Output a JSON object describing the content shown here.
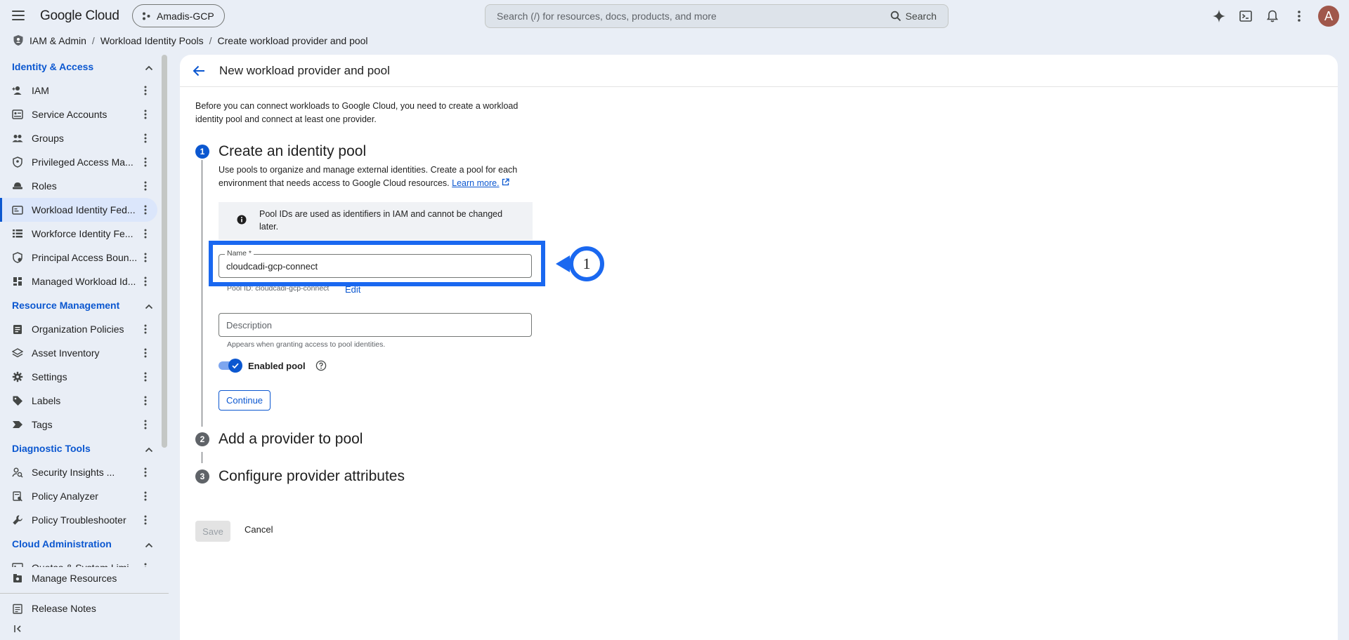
{
  "topbar": {
    "logo": "Google Cloud",
    "project": "Amadis-GCP",
    "search_placeholder": "Search (/) for resources, docs, products, and more",
    "search_button": "Search",
    "avatar_initial": "A"
  },
  "breadcrumb": {
    "section": "IAM & Admin",
    "parent": "Workload Identity Pools",
    "current": "Create workload provider and pool",
    "separator": "/"
  },
  "sidebar": {
    "sections": [
      {
        "title": "Identity & Access",
        "items": [
          {
            "label": "IAM",
            "icon": "person-add-icon"
          },
          {
            "label": "Service Accounts",
            "icon": "service-account-icon"
          },
          {
            "label": "Groups",
            "icon": "groups-icon"
          },
          {
            "label": "Privileged Access Ma...",
            "icon": "shield-icon"
          },
          {
            "label": "Roles",
            "icon": "roles-icon"
          },
          {
            "label": "Workload Identity Fed...",
            "icon": "id-card-icon",
            "active": true
          },
          {
            "label": "Workforce Identity Fe...",
            "icon": "list-icon"
          },
          {
            "label": "Principal Access Boun...",
            "icon": "policy-shield-icon"
          },
          {
            "label": "Managed Workload Id...",
            "icon": "dashboard-icon"
          }
        ]
      },
      {
        "title": "Resource Management",
        "items": [
          {
            "label": "Organization Policies",
            "icon": "document-icon"
          },
          {
            "label": "Asset Inventory",
            "icon": "layers-icon"
          },
          {
            "label": "Settings",
            "icon": "gear-icon"
          },
          {
            "label": "Labels",
            "icon": "tag-icon"
          },
          {
            "label": "Tags",
            "icon": "label-arrow-icon"
          }
        ]
      },
      {
        "title": "Diagnostic Tools",
        "items": [
          {
            "label": "Security Insights ...",
            "icon": "person-search-icon"
          },
          {
            "label": "Policy Analyzer",
            "icon": "analyzer-icon"
          },
          {
            "label": "Policy Troubleshooter",
            "icon": "wrench-icon"
          }
        ]
      },
      {
        "title": "Cloud Administration",
        "items": [
          {
            "label": "Quotas & System Limi...",
            "icon": "quota-icon"
          }
        ]
      }
    ],
    "bottom": [
      {
        "label": "Manage Resources",
        "icon": "manage-resources-icon"
      },
      {
        "label": "Release Notes",
        "icon": "notes-icon"
      }
    ]
  },
  "main": {
    "title": "New workload provider and pool",
    "intro": "Before you can connect workloads to Google Cloud, you need to create a workload identity pool and connect at least one provider.",
    "steps": [
      {
        "number": "1",
        "title": "Create an identity pool"
      },
      {
        "number": "2",
        "title": "Add a provider to pool"
      },
      {
        "number": "3",
        "title": "Configure provider attributes"
      }
    ],
    "step1": {
      "description": "Use pools to organize and manage external identities. Create a pool for each environment that needs access to Google Cloud resources.",
      "learn_more": "Learn more.",
      "info": "Pool IDs are used as identifiers in IAM and cannot be changed later.",
      "name_label": "Name *",
      "name_value": "cloudcadi-gcp-connect",
      "pool_id_hint": "Pool ID: cloudcadi-gcp-connect",
      "edit_label": "Edit",
      "description_placeholder": "Description",
      "description_hint": "Appears when granting access to pool identities.",
      "enabled_label": "Enabled pool",
      "enabled": true,
      "continue_label": "Continue"
    },
    "save_label": "Save",
    "cancel_label": "Cancel"
  },
  "annotation": {
    "callout_number": "1",
    "color": "#1a68f0"
  }
}
